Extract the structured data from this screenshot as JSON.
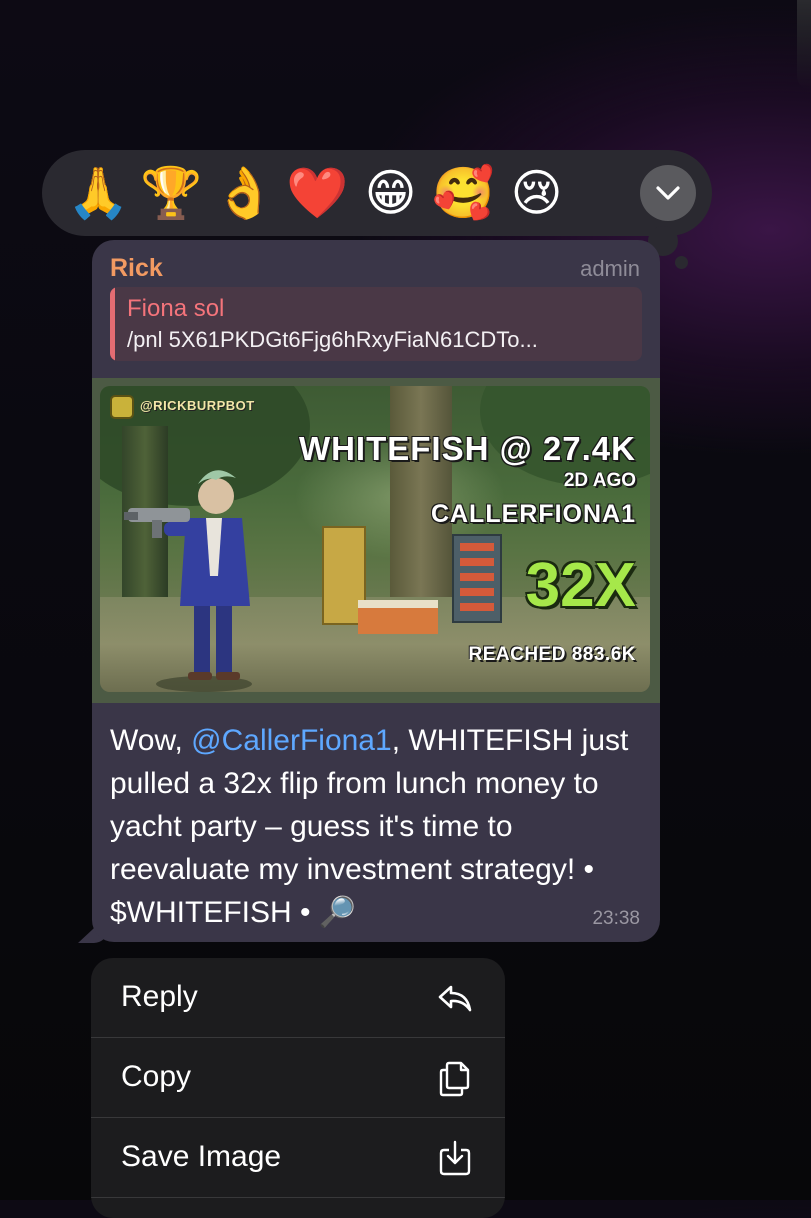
{
  "reactions": [
    "🙏",
    "🏆",
    "👌",
    "❤️",
    "😁",
    "🥰",
    "😢"
  ],
  "message": {
    "sender": "Rick",
    "role": "admin",
    "reply": {
      "author": "Fiona sol",
      "text": "/pnl 5X61PKDGt6Fjg6hRxyFiaN61CDTo..."
    },
    "card": {
      "bot_handle": "@RICKBURPBOT",
      "title": "WHITEFISH @ 27.4K",
      "age": "2D AGO",
      "caller": "CALLERFIONA1",
      "multiple": "32X",
      "reached": "REACHED 883.6K"
    },
    "text": {
      "prefix": "Wow, ",
      "mention": "@CallerFiona1",
      "body": ", WHITEFISH just pulled a 32x flip from lunch money to yacht party – guess it's time to reevaluate my investment strategy! • $WHITEFISH • 🔎"
    },
    "time": "23:38"
  },
  "menu": {
    "items": [
      {
        "label": "Reply",
        "icon": "reply-icon"
      },
      {
        "label": "Copy",
        "icon": "copy-icon"
      },
      {
        "label": "Save Image",
        "icon": "save-image-icon"
      }
    ]
  },
  "colors": {
    "sender": "#f29a62",
    "reply_accent": "#e36c72",
    "mention": "#5ea8ff",
    "multiple": "#a6e84a",
    "bubble": "#3a3648"
  }
}
